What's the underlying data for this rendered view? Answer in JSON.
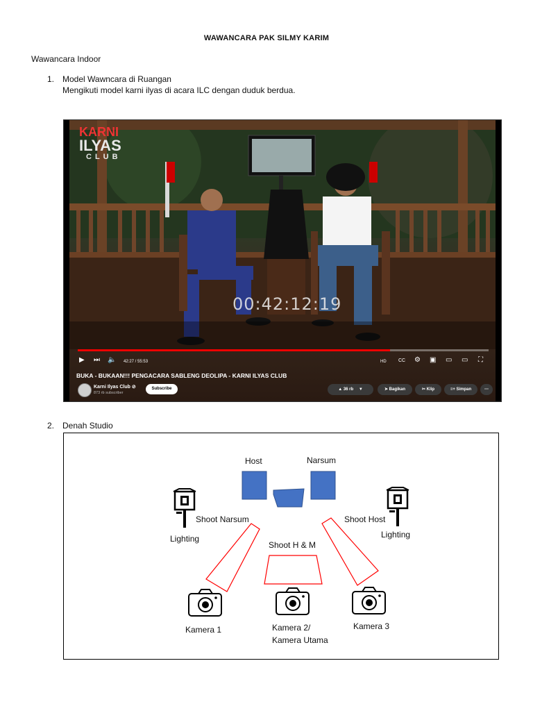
{
  "document": {
    "title": "WAWANCARA PAK SILMY KARIM",
    "section_label": "Wawancara Indoor",
    "items": [
      {
        "number": "1.",
        "text": "Model Wawncara di Ruangan",
        "subtext": "Mengikuti model karni ilyas di acara ILC dengan duduk berdua."
      },
      {
        "number": "2.",
        "text": "Denah Studio"
      }
    ]
  },
  "video": {
    "brand_line1": "KARNI",
    "brand_line2": "ILYAS",
    "brand_line3": "CLUB",
    "timecode": "00:42:12:19",
    "time_display": "42:27 / 55:53",
    "progress_fraction": 0.76,
    "title": "BUKA - BUKAAN!!! PENGACARA SABLENG DEOLIPA - KARNI ILYAS CLUB",
    "channel_name": "Karni Ilyas Club",
    "verified_glyph": "⊘",
    "subscribers": "873 rb subscriber",
    "subscribe_label": "Subscribe",
    "like_count": "36 rb",
    "share_label": "Bagikan",
    "clip_label": "Klip",
    "save_label": "Simpan",
    "more_glyph": "⋯",
    "icons": {
      "play": "▶",
      "next": "⏭",
      "volume": "🔈",
      "hd": "HD",
      "captions": "CC",
      "settings": "⚙",
      "miniplayer": "▣",
      "theater": "▭",
      "cast": "▭",
      "fullscreen": "⛶"
    }
  },
  "diagram": {
    "host_label": "Host",
    "narsum_label": "Narsum",
    "lighting_left_label": "Lighting",
    "lighting_right_label": "Lighting",
    "shoot_narsum_label": "Shoot Narsum",
    "shoot_host_label": "Shoot Host",
    "shoot_hm_label": "Shoot H & M",
    "camera1_label": "Kamera 1",
    "camera2_label_line1": "Kamera 2/",
    "camera2_label_line2": "Kamera Utama",
    "camera3_label": "Kamera 3",
    "colors": {
      "seat_fill": "#4472c4",
      "seat_stroke": "#2f528f",
      "frustum": "#ff0000"
    }
  }
}
